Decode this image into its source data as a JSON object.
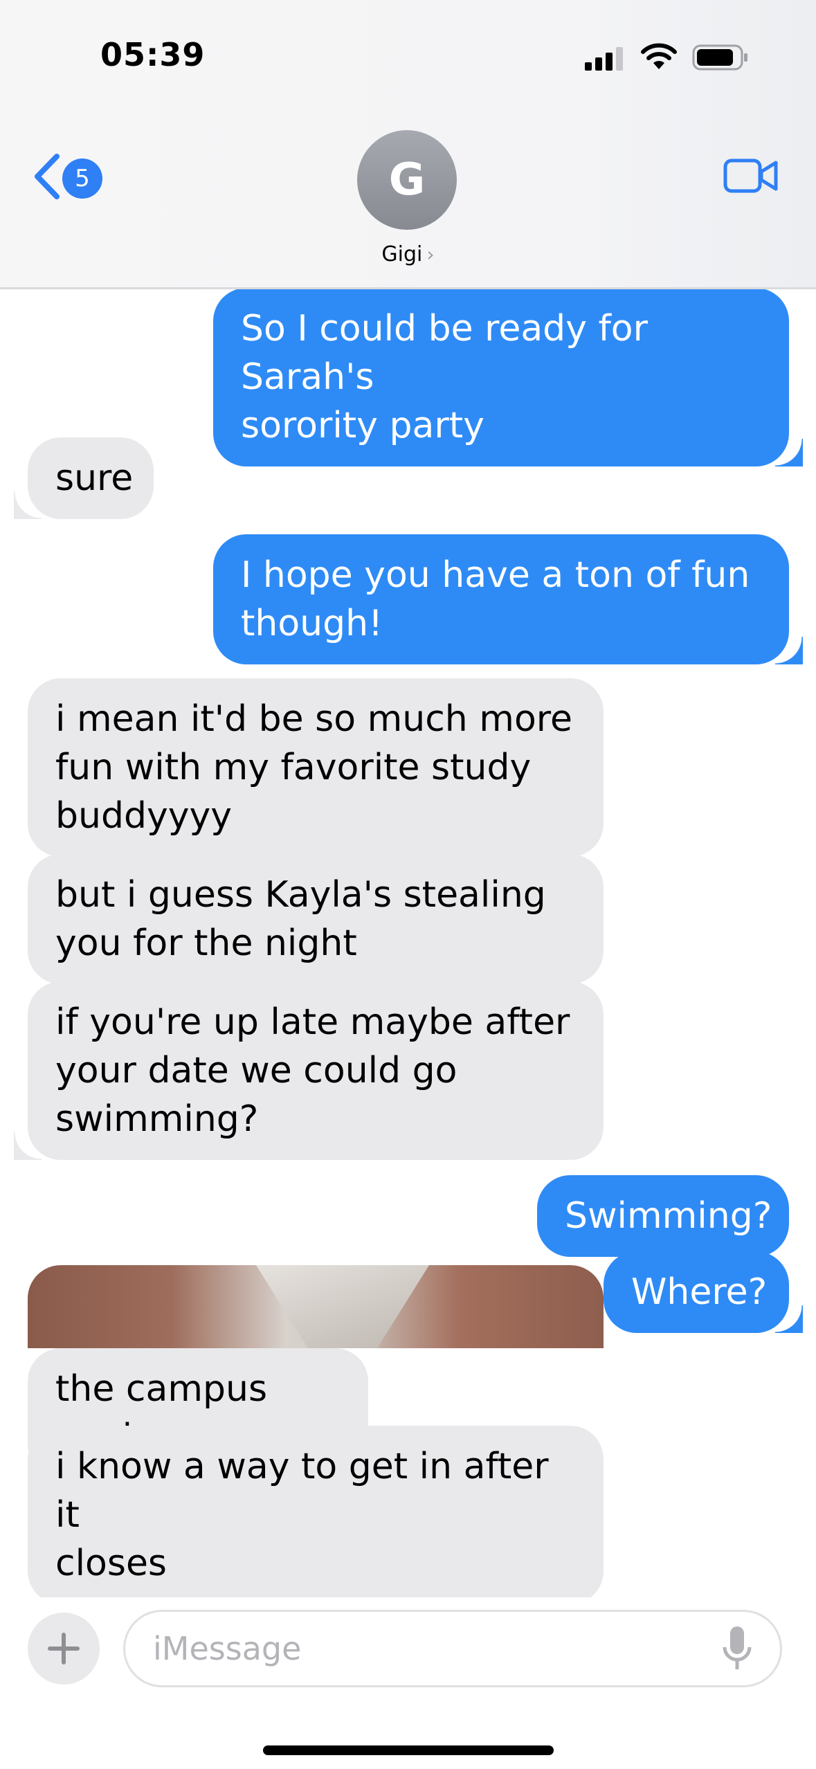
{
  "status_bar": {
    "time": "05:39"
  },
  "header": {
    "back_badge": "5",
    "avatar_initial": "G",
    "contact_name": "Gigi",
    "contact_chevron": "›"
  },
  "messages": [
    {
      "direction": "outgoing",
      "text": "So I could be ready for Sarah's\nsorority party"
    },
    {
      "direction": "incoming",
      "text": "sure"
    },
    {
      "direction": "outgoing",
      "text": "I hope you have a ton of fun\nthough!"
    },
    {
      "direction": "incoming",
      "text": "i mean it'd be so much more\nfun with my favorite study\nbuddyyyy"
    },
    {
      "direction": "incoming",
      "text": "but i guess Kayla's stealing\nyou for the night"
    },
    {
      "direction": "incoming",
      "text": "if you're up late maybe after\nyour date we could go\nswimming?"
    },
    {
      "direction": "outgoing",
      "text": "Swimming?"
    },
    {
      "direction": "outgoing",
      "text": "Where?"
    },
    {
      "direction": "incoming",
      "text": "the campus pool"
    },
    {
      "direction": "incoming",
      "text": "i know a way to get in after it\ncloses"
    }
  ],
  "composer": {
    "placeholder": "iMessage"
  },
  "colors": {
    "accent": "#2e8bf6",
    "incoming_bubble": "#e9e9eb",
    "badge": "#2f7ff5"
  },
  "icons": [
    "back-chevron-icon",
    "video-camera-icon",
    "plus-icon",
    "microphone-icon",
    "cellular-signal-icon",
    "wifi-icon",
    "battery-icon"
  ]
}
